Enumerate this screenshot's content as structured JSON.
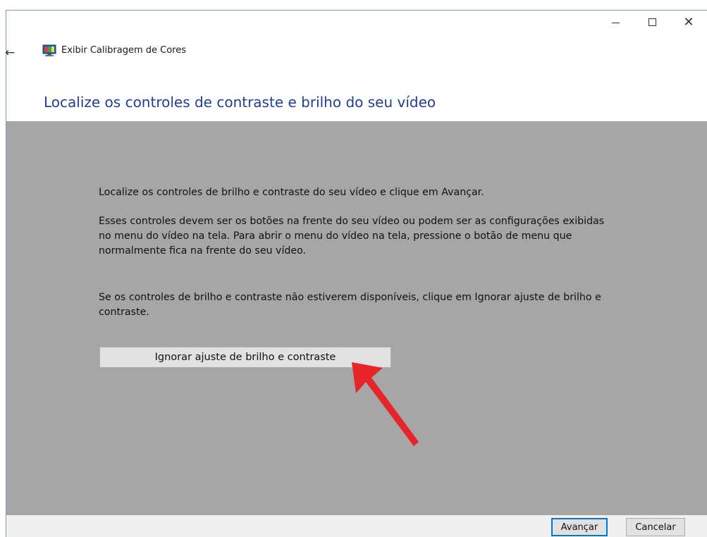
{
  "window": {
    "title": "Exibir Calibragem de Cores",
    "controls": {
      "minimize_icon": "minimize-icon",
      "maximize_icon": "maximize-icon",
      "close_icon": "close-icon",
      "close_glyph": "✕"
    },
    "back_glyph": "←"
  },
  "page": {
    "heading": "Localize os controles de contraste e brilho do seu vídeo",
    "paragraphs": [
      "Localize os controles de brilho e contraste do seu vídeo e clique em Avançar.",
      "Esses controles devem ser os botões na frente do seu vídeo ou podem ser as configurações exibidas no menu do vídeo na tela. Para abrir o menu do vídeo na tela, pressione o botão de menu que normalmente fica na frente do seu vídeo.",
      "Se os controles de brilho e contraste não estiverem disponíveis, clique em Ignorar ajuste de brilho e contraste."
    ],
    "skip_button": "Ignorar ajuste de brilho e contraste"
  },
  "footer": {
    "next_label": "Avançar",
    "cancel_label": "Cancelar"
  },
  "colors": {
    "heading": "#1f3f99",
    "panel": "#a6a6a6",
    "annotation_arrow": "#e8242b"
  }
}
